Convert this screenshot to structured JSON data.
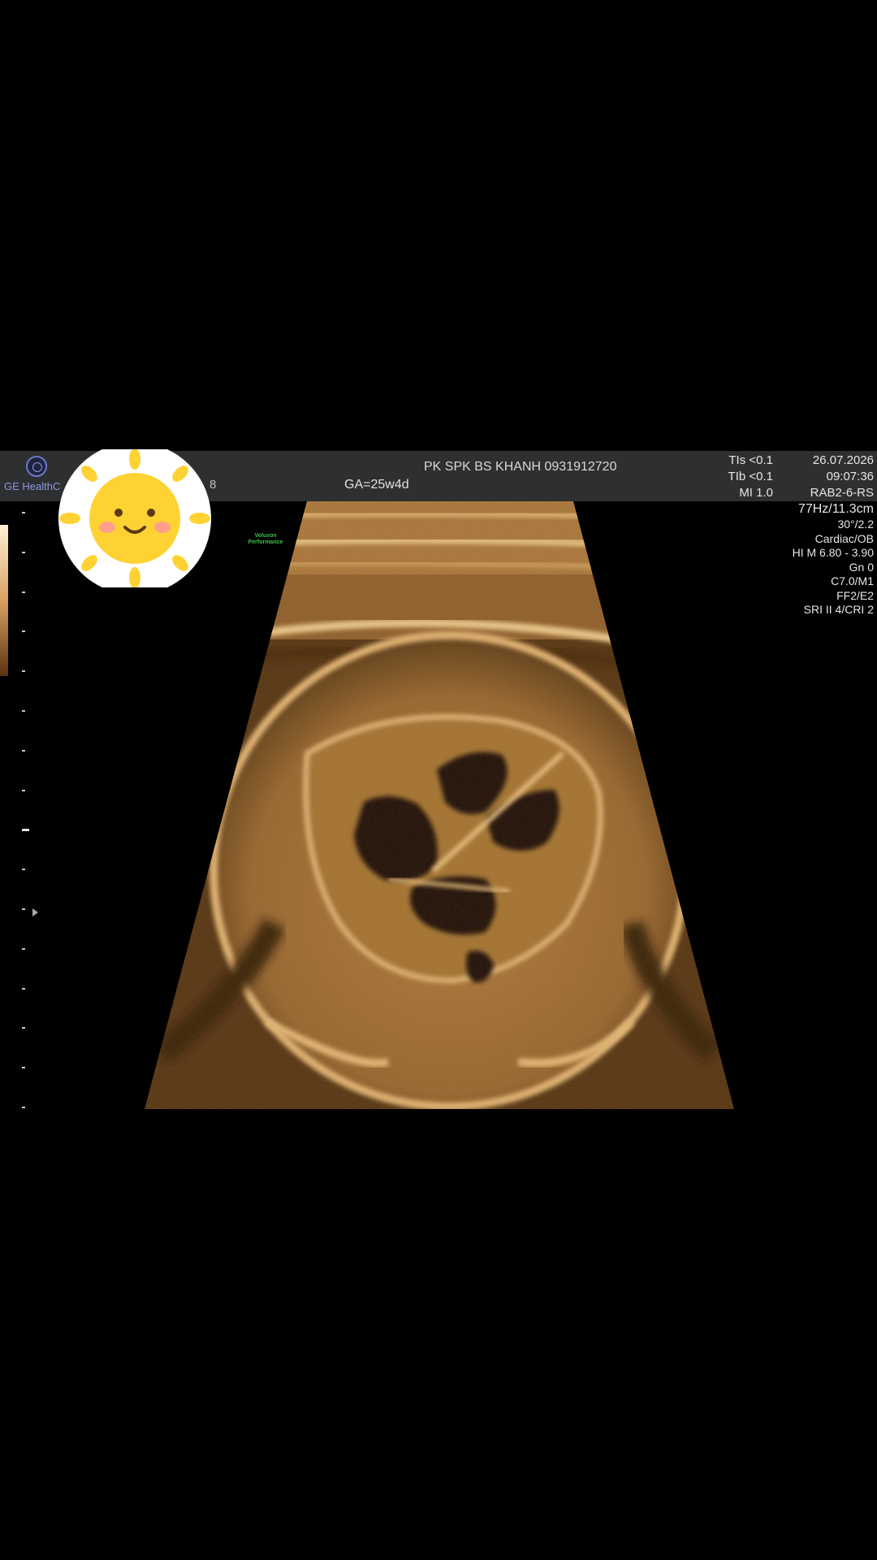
{
  "header": {
    "brand_text": "GE HealthC",
    "partial_text": "8",
    "clinic": "PK SPK BS KHANH 0931912720",
    "gestational_age": "GA=25w4d",
    "tis": "TIs <0.1",
    "tib": "TIb <0.1",
    "mi": "MI  1.0",
    "date": "26.07.2026",
    "time": "09:07:36",
    "probe": "RAB2-6-RS"
  },
  "side_params": {
    "frame_rate": "77Hz/11.3cm",
    "angle": "30°/2.2",
    "preset": "Cardiac/OB",
    "harmonic": "HI M  6.80 - 3.90",
    "gain": "Gn  0",
    "color": "C7.0/M1",
    "ff": "FF2/E2",
    "sri": "SRI II 4/CRI 2"
  },
  "voluson": {
    "line1": "Voluson",
    "line2": "Performance"
  },
  "icons": {
    "ge_logo": "ge-logo-icon",
    "sticker": "sun-sticker-icon"
  },
  "colors": {
    "header_bg": "#2d2f31",
    "tissue": "#c08a48",
    "brand": "#8d98e0",
    "voluson": "#3fbf4a"
  }
}
